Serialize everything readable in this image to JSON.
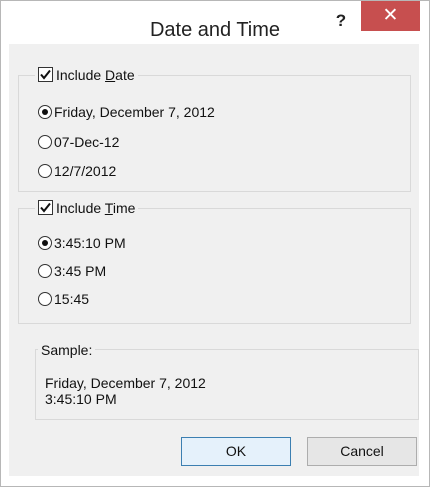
{
  "window": {
    "title": "Date and Time",
    "help_label": "?",
    "close_label": "✕"
  },
  "date_group": {
    "checkbox_label_pre": "Include ",
    "checkbox_label_key": "D",
    "checkbox_label_post": "ate",
    "checked": true,
    "options": [
      {
        "label": "Friday, December 7, 2012",
        "selected": true
      },
      {
        "label": "07-Dec-12",
        "selected": false
      },
      {
        "label": "12/7/2012",
        "selected": false
      }
    ]
  },
  "time_group": {
    "checkbox_label_pre": "Include ",
    "checkbox_label_key": "T",
    "checkbox_label_post": "ime",
    "checked": true,
    "options": [
      {
        "label": "3:45:10 PM",
        "selected": true
      },
      {
        "label": "3:45 PM",
        "selected": false
      },
      {
        "label": "15:45",
        "selected": false
      }
    ]
  },
  "sample": {
    "legend": "Sample:",
    "line1": "Friday, December 7, 2012",
    "line2": "3:45:10 PM"
  },
  "buttons": {
    "ok": "OK",
    "cancel": "Cancel"
  },
  "colors": {
    "close_button": "#c74f4f",
    "dialog_background": "#f0f0f0",
    "default_button_border": "#3c7fb1"
  },
  "icons": {
    "help": "question-mark-icon",
    "close": "close-icon",
    "check": "checkmark-icon"
  }
}
